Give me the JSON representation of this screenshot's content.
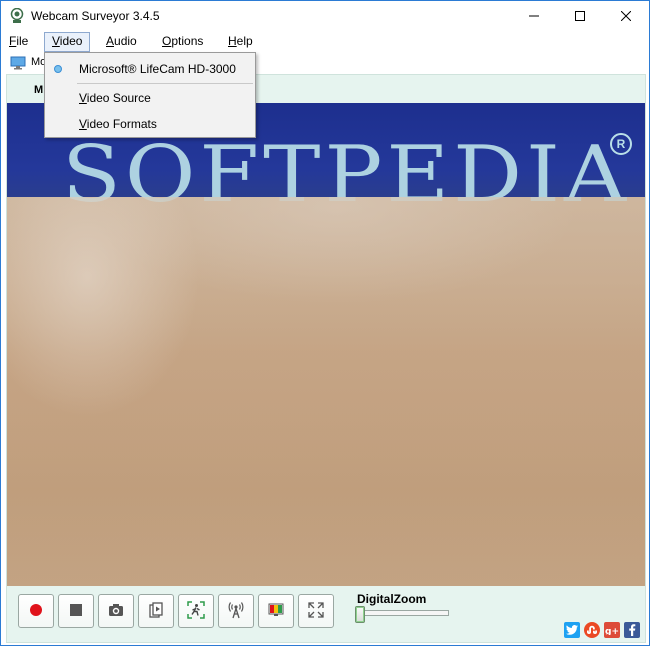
{
  "window": {
    "title": "Webcam Surveyor 3.4.5"
  },
  "menubar": {
    "items": [
      {
        "label": "File",
        "underline": "F",
        "rest": "ile"
      },
      {
        "label": "Video",
        "underline": "V",
        "rest": "ideo"
      },
      {
        "label": "Audio",
        "underline": "A",
        "rest": "udio"
      },
      {
        "label": "Options",
        "underline": "O",
        "rest": "ptions"
      },
      {
        "label": "Help",
        "underline": "H",
        "rest": "elp"
      }
    ],
    "active": "Video"
  },
  "toolbar": {
    "visible_text": "Mo",
    "icon": "monitor-icon"
  },
  "camera_panel": {
    "tab_label_visible": "M",
    "video_logo_text": "SOFTPEDIA",
    "video_logo_mark": "R"
  },
  "video_menu": {
    "device": "Microsoft® LifeCam HD-3000",
    "device_selected": true,
    "items": [
      {
        "label": "Video Source",
        "underline": "V",
        "rest": "ideo Source"
      },
      {
        "label": "Video Formats",
        "underline": "V",
        "rest": "ideo Formats"
      }
    ]
  },
  "controls": {
    "buttons": [
      {
        "name": "record-button",
        "icon": "record-icon"
      },
      {
        "name": "stop-button",
        "icon": "stop-icon"
      },
      {
        "name": "snapshot-button",
        "icon": "camera-icon"
      },
      {
        "name": "playback-button",
        "icon": "play-file-icon"
      },
      {
        "name": "motion-detection-button",
        "icon": "motion-icon"
      },
      {
        "name": "broadcast-button",
        "icon": "antenna-icon"
      },
      {
        "name": "color-settings-button",
        "icon": "color-icon"
      },
      {
        "name": "fullscreen-button",
        "icon": "fullscreen-icon"
      }
    ],
    "zoom_label": "DigitalZoom",
    "zoom_level": 0,
    "colors": {
      "record": "#e0131b",
      "stop": "#555555",
      "accent_green": "#2e9b4b"
    }
  },
  "social": [
    {
      "name": "twitter",
      "glyph": "t",
      "color": "#1da1f2"
    },
    {
      "name": "stumbleupon",
      "glyph": "s",
      "color": "#eb4924"
    },
    {
      "name": "google-plus",
      "glyph": "g+",
      "color": "#dd4b39"
    },
    {
      "name": "facebook",
      "glyph": "f",
      "color": "#3b5998"
    }
  ]
}
